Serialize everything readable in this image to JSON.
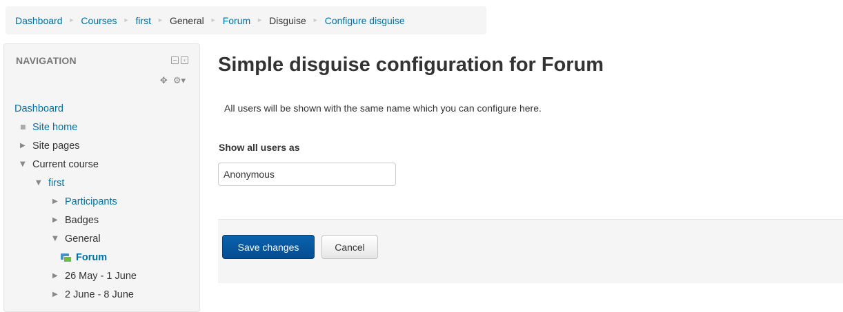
{
  "breadcrumb": [
    {
      "label": "Dashboard",
      "link": true
    },
    {
      "label": "Courses",
      "link": true
    },
    {
      "label": "first",
      "link": true
    },
    {
      "label": "General",
      "link": false
    },
    {
      "label": "Forum",
      "link": true
    },
    {
      "label": "Disguise",
      "link": false
    },
    {
      "label": "Configure disguise",
      "link": true
    }
  ],
  "breadcrumb_separator": "►",
  "navigation": {
    "title": "NAVIGATION",
    "items": [
      {
        "label": "Dashboard"
      },
      {
        "label": "Site home",
        "icon": "bullet-icon"
      },
      {
        "label": "Site pages",
        "icon": "collapsed-arrow-icon"
      },
      {
        "label": "Current course",
        "icon": "expanded-arrow-icon"
      },
      {
        "label": "first",
        "icon": "expanded-arrow-icon"
      },
      {
        "label": "Participants",
        "icon": "collapsed-arrow-icon"
      },
      {
        "label": "Badges",
        "icon": "collapsed-arrow-icon"
      },
      {
        "label": "General",
        "icon": "expanded-arrow-icon"
      },
      {
        "label": "Forum",
        "icon": "forum-icon"
      },
      {
        "label": "26 May - 1 June",
        "icon": "collapsed-arrow-icon"
      },
      {
        "label": "2 June - 8 June",
        "icon": "collapsed-arrow-icon"
      }
    ]
  },
  "main": {
    "title": "Simple disguise configuration for Forum",
    "intro": "All users will be shown with the same name which you can configure here.",
    "field_label": "Show all users as",
    "field_value": "Anonymous",
    "save_label": "Save changes",
    "cancel_label": "Cancel"
  },
  "colors": {
    "link": "#0070a8",
    "primary_button": "#0b5aa3",
    "panel_bg": "#f5f5f5"
  }
}
